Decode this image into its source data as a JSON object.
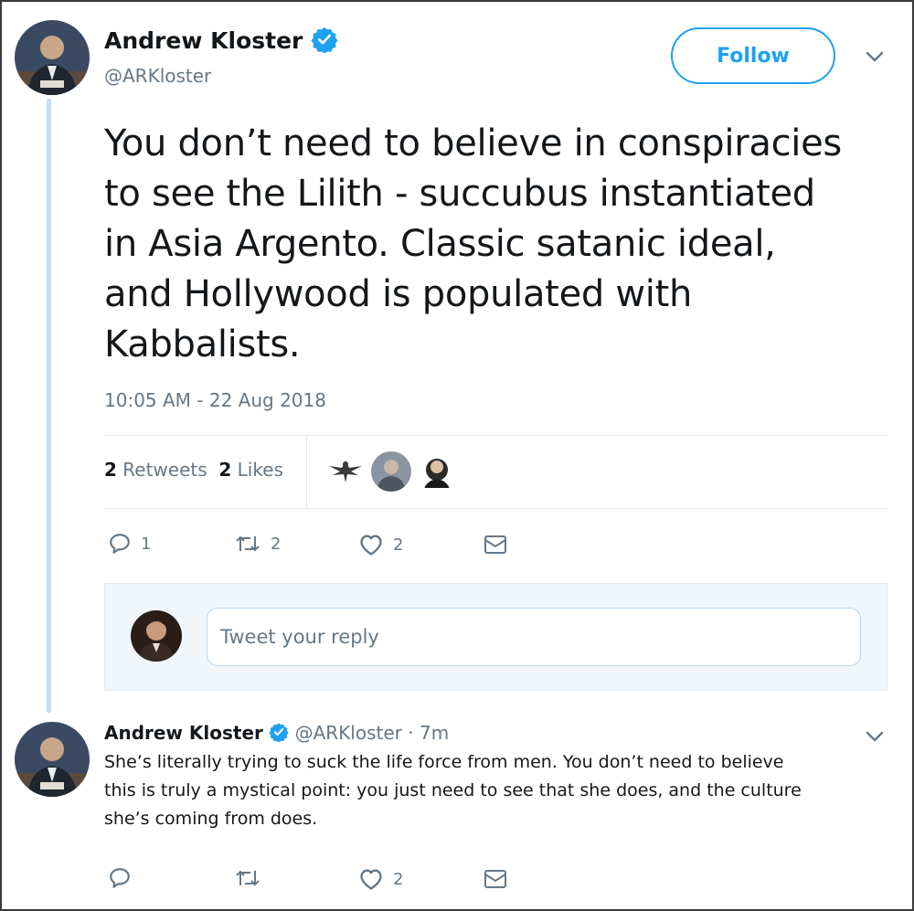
{
  "tweet": {
    "author_name": "Andrew Kloster",
    "author_handle": "@ARKloster",
    "follow_label": "Follow",
    "text_lines": [
      "You don’t need to believe in conspiracies",
      "to see the Lilith - succubus instantiated",
      "in Asia Argento.  Classic satanic ideal,",
      "and Hollywood is populated with",
      "Kabbalists."
    ],
    "timestamp": "10:05 AM - 22 Aug 2018",
    "stats": {
      "retweets_count": "2",
      "retweets_label": "Retweets",
      "likes_count": "2",
      "likes_label": "Likes"
    },
    "actions": {
      "reply_count": "1",
      "retweet_count": "2",
      "like_count": "2"
    }
  },
  "reply_box": {
    "placeholder": "Tweet your reply"
  },
  "reply": {
    "author_name": "Andrew Kloster",
    "author_handle": "@ARKloster",
    "time": "· 7m",
    "text_lines": [
      "She’s literally trying to suck the life force from men.  You don’t need to believe",
      "this is truly a mystical point: you just need to see that she does, and the culture",
      "she’s coming from does."
    ],
    "actions": {
      "like_count": "2"
    }
  },
  "colors": {
    "accent": "#1da1f2",
    "thread_line": "#c4dff5",
    "muted_text": "#657786",
    "reply_box_bg": "#f0f6fa"
  },
  "icons": [
    "verified-badge-icon",
    "chevron-down-icon",
    "reply-icon",
    "retweet-icon",
    "heart-icon",
    "message-icon"
  ]
}
